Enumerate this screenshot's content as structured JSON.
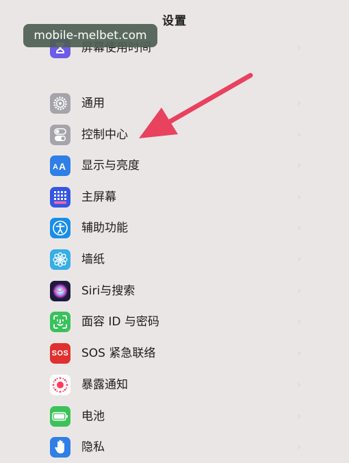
{
  "header": {
    "title": "设置"
  },
  "watermark": {
    "text": "mobile-melbet.com"
  },
  "annotation": {
    "arrow_color": "#e8425f"
  },
  "settings": {
    "items": [
      {
        "label": "屏幕使用时间",
        "icon": "hourglass-icon",
        "color": "#6c5ce7"
      },
      {
        "label": "通用",
        "icon": "gear-icon",
        "color": "#a5a4aa"
      },
      {
        "label": "控制中心",
        "icon": "toggles-icon",
        "color": "#a5a4aa"
      },
      {
        "label": "显示与亮度",
        "icon": "text-size-icon",
        "color": "#2f7fe6"
      },
      {
        "label": "主屏幕",
        "icon": "app-grid-icon",
        "color": "#3556e2"
      },
      {
        "label": "辅助功能",
        "icon": "accessibility-icon",
        "color": "#1a8de6"
      },
      {
        "label": "墙纸",
        "icon": "flower-icon",
        "color": "#36aee8"
      },
      {
        "label": "Siri与搜索",
        "icon": "siri-icon",
        "color": "#1e1a3c"
      },
      {
        "label": "面容 ID 与密码",
        "icon": "face-id-icon",
        "color": "#38c25c"
      },
      {
        "label": "SOS 紧急联络",
        "icon": "sos-icon",
        "color": "#e0302f"
      },
      {
        "label": "暴露通知",
        "icon": "exposure-icon",
        "color": "#ffffff"
      },
      {
        "label": "电池",
        "icon": "battery-icon",
        "color": "#3dc25a"
      },
      {
        "label": "隐私",
        "icon": "hand-icon",
        "color": "#2f7fe6"
      }
    ],
    "sos_icon_text": "SOS"
  }
}
